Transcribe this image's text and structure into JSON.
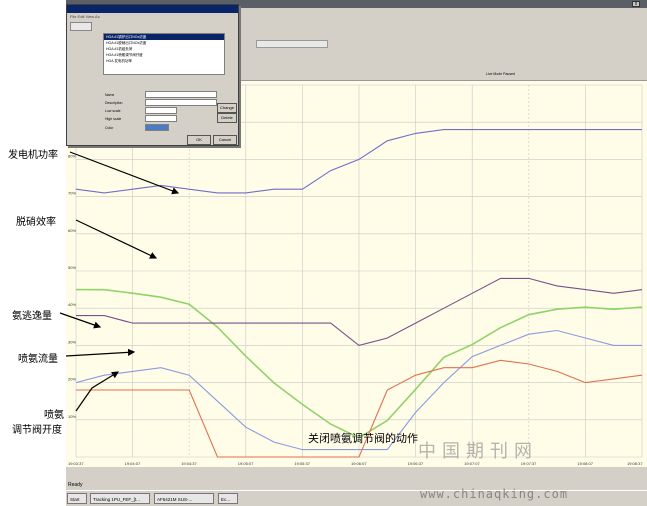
{
  "annotations": {
    "generator_power": "发电机功率",
    "denitration_efficiency": "脱硝效率",
    "ammonia_selection": "氨逃逸量",
    "ammonia_flow": "喷氨流量",
    "valve_opening_line1": "喷氨",
    "valve_opening_line2": "调节阀开度"
  },
  "caption": "关闭喷氨调节阀的动作",
  "watermark": {
    "cn": "中国期刊网",
    "url": "www.chinaqking.com"
  },
  "colors": {
    "plot_bg": "#fffde8",
    "generator_power": "#6f6fc8",
    "denitration_efficiency": "#8fd36a",
    "ammonia_selection": "#7a4f8c",
    "ammonia_flow": "#8a9ae0",
    "valve_opening": "#e07050",
    "valve_step": "#e07070"
  },
  "status_bar": "Ready",
  "live_mode": "Live Mode   Paused",
  "taskbar": [
    "Start",
    "Tracking 1PU_FEF_[t...",
    "AF6421M SUS-...",
    "Ec..."
  ],
  "chart_data": {
    "type": "line",
    "title": "",
    "xlabel": "",
    "ylabel": "",
    "x": [
      0,
      5,
      10,
      15,
      20,
      25,
      30,
      35,
      40,
      45,
      50,
      55,
      60,
      65,
      70,
      75,
      80,
      85,
      90,
      95,
      100
    ],
    "series": [
      {
        "values": [
          72,
          71,
          72,
          73,
          72,
          71,
          71,
          72,
          72,
          77,
          80,
          85,
          87,
          88,
          88,
          88,
          88,
          88,
          88,
          88,
          88
        ]
      },
      {
        "values": [
          45,
          45,
          44,
          43,
          41,
          35,
          27,
          20,
          14,
          9,
          5,
          10,
          18,
          27,
          30,
          35,
          38,
          40,
          40,
          40,
          40
        ]
      },
      {
        "values": [
          38,
          38,
          36,
          36,
          36,
          36,
          36,
          36,
          36,
          36,
          30,
          32,
          36,
          40,
          44,
          48,
          48,
          46,
          45,
          44,
          45
        ]
      },
      {
        "values": [
          20,
          22,
          23,
          24,
          22,
          15,
          8,
          4,
          2,
          2,
          2,
          2,
          12,
          20,
          27,
          30,
          33,
          34,
          32,
          30,
          30
        ]
      },
      {
        "values": [
          18,
          18,
          18,
          18,
          18,
          0,
          0,
          0,
          0,
          0,
          0,
          18,
          22,
          24,
          24,
          26,
          25,
          23,
          20,
          21,
          22
        ]
      }
    ],
    "x_tick_labels": [
      "19:03:37",
      "19:04:07",
      "19:04:37",
      "19:05:07",
      "19:05:37",
      "19:06:07",
      "19:06:37",
      "19:07:07",
      "19:07:37",
      "19:08:07",
      "19:08:37"
    ],
    "y_tick_labels": [
      "90%",
      "80%",
      "70%",
      "60%",
      "50%",
      "40%",
      "30%",
      "20%",
      "10%"
    ],
    "ylim": [
      0,
      100
    ],
    "grid": true,
    "legend": "none"
  },
  "dialog": {
    "menu": "File  Edit  View  Ac",
    "rows": [
      "HGA  #1锅炉出口NOx浓度",
      "HGA  #1脱硝出口NOx浓度",
      "HGA  #1机组负荷",
      "HGA  #1喷氨调节阀开度",
      "HGA  发电机功率"
    ],
    "name_label": "Name",
    "desc_label": "Description",
    "low_label": "Low scale",
    "high_label": "High scale",
    "color_label": "Color",
    "change_btn": "Change",
    "delete_btn": "Delete",
    "ok_btn": "OK",
    "cancel_btn": "Cancel"
  }
}
